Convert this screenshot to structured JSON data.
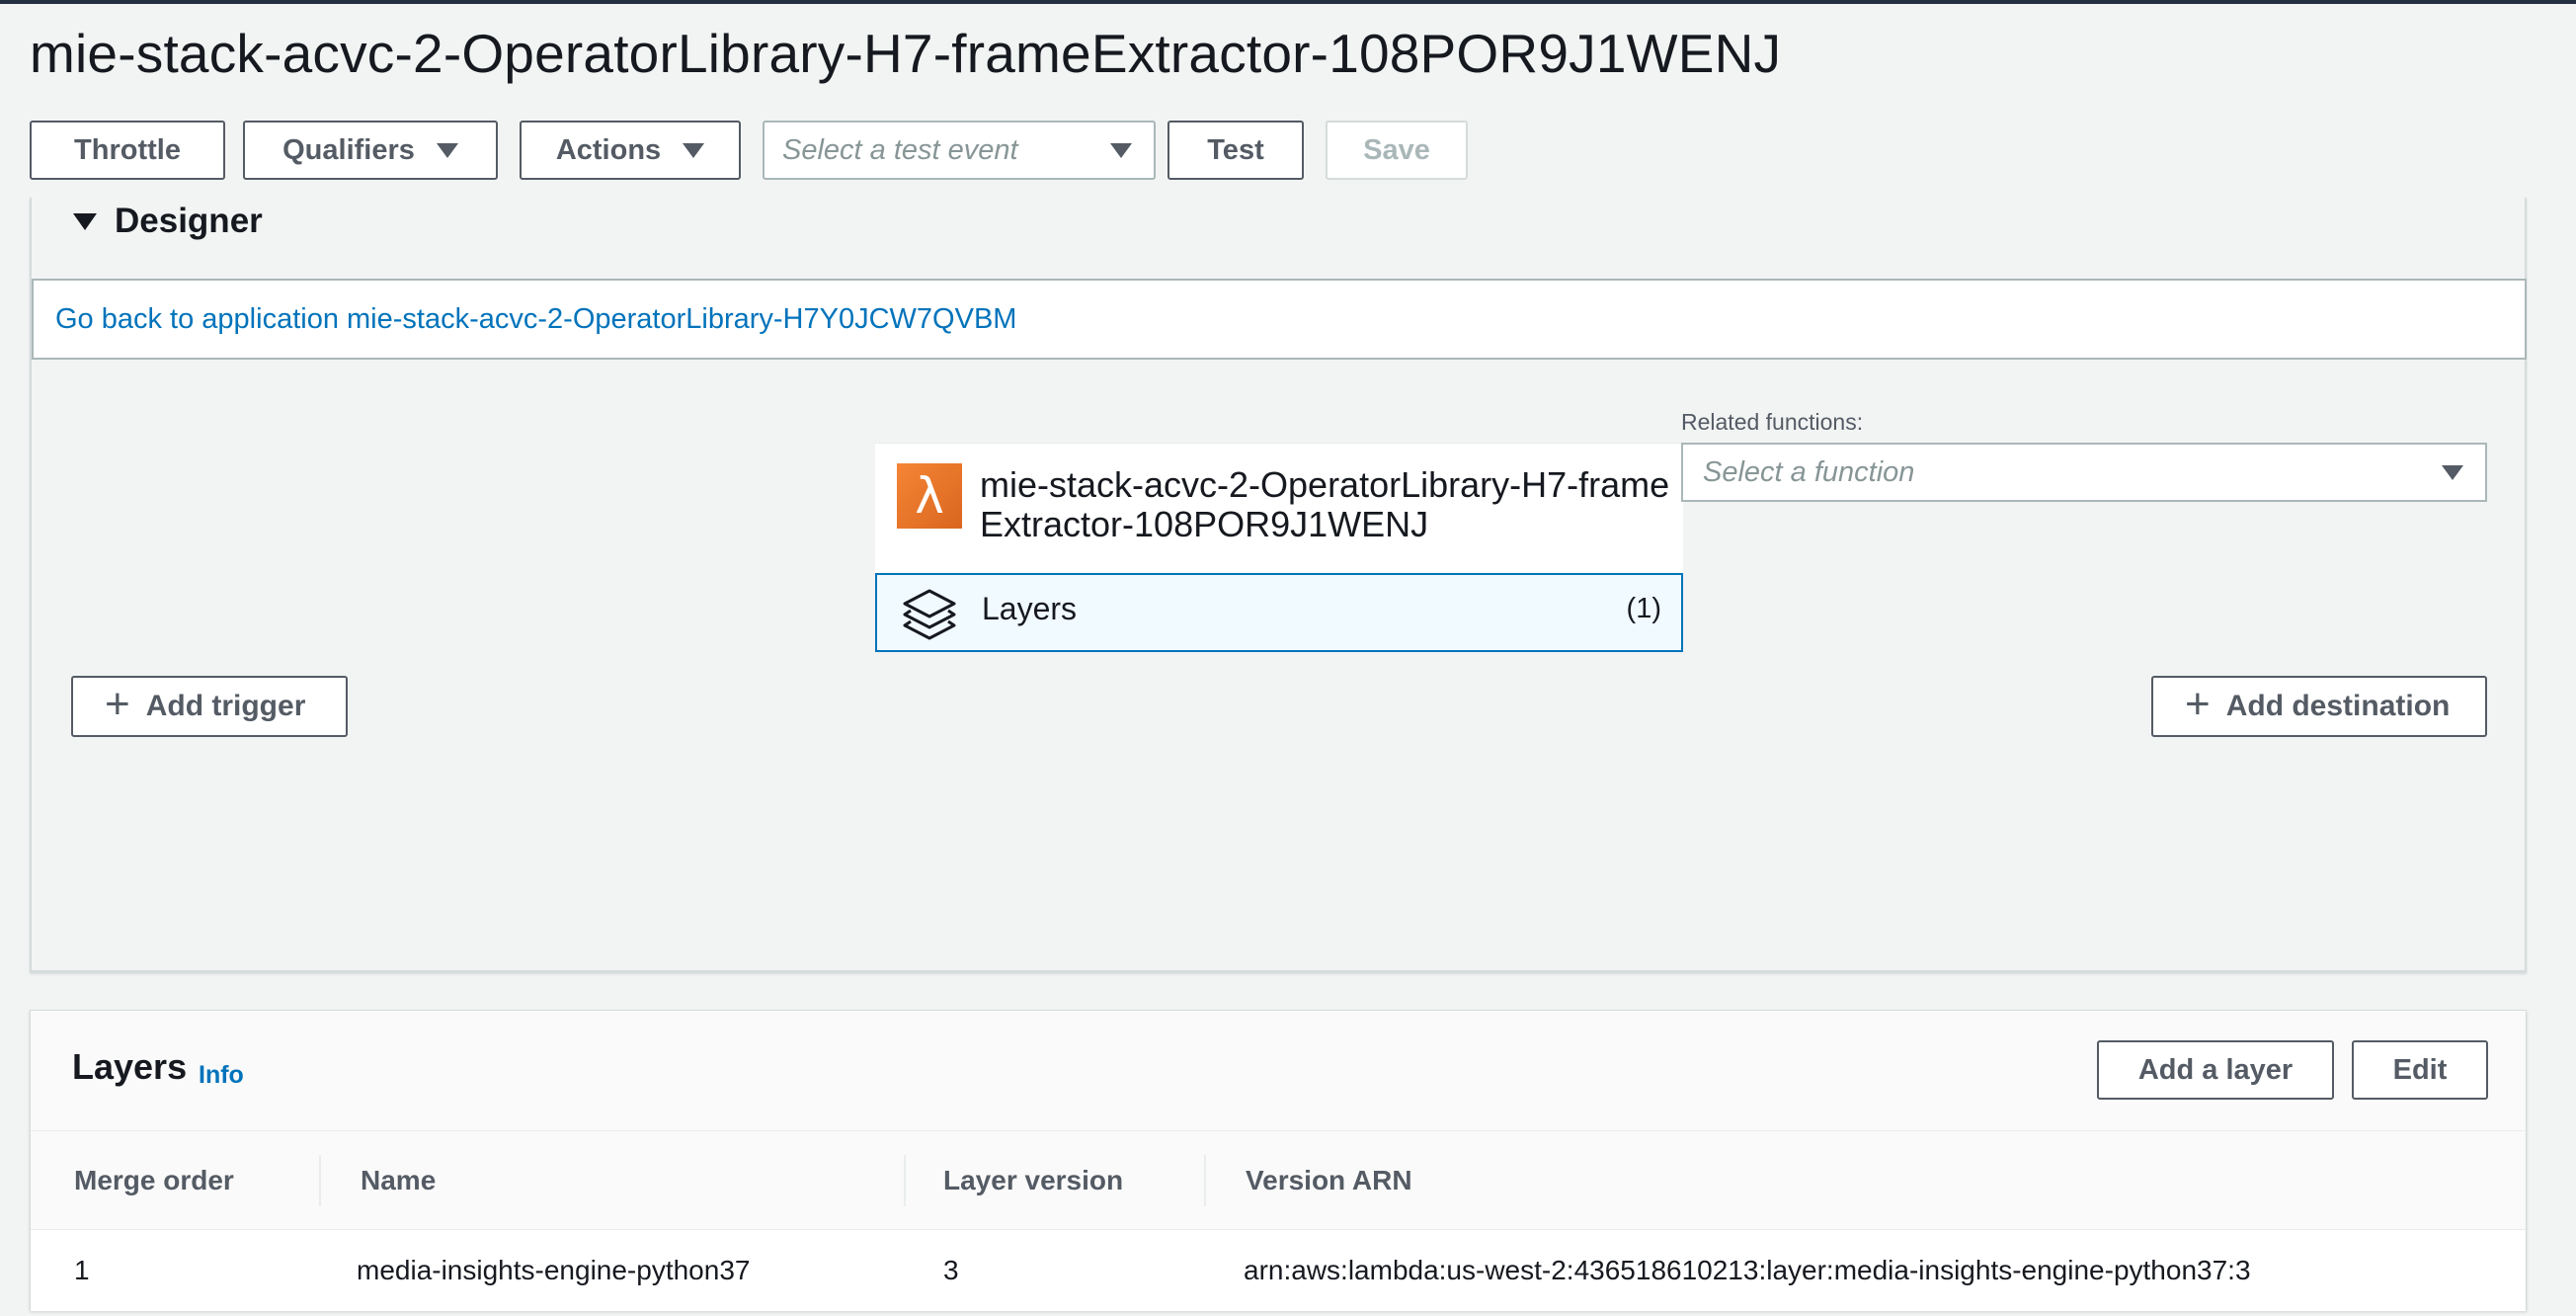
{
  "page": {
    "title": "mie-stack-acvc-2-OperatorLibrary-H7-frameExtractor-108POR9J1WENJ"
  },
  "toolbar": {
    "throttle": "Throttle",
    "qualifiers": "Qualifiers",
    "actions": "Actions",
    "test_event_placeholder": "Select a test event",
    "test": "Test",
    "save": "Save"
  },
  "designer": {
    "heading": "Designer",
    "go_back_link": "Go back to application mie-stack-acvc-2-OperatorLibrary-H7Y0JCW7QVBM",
    "function_name": "mie-stack-acvc-2-OperatorLibrary-H7-frameExtractor-108POR9J1WENJ",
    "function_icon": "λ",
    "layers_label": "Layers",
    "layers_count": "(1)",
    "related_functions_label": "Related functions:",
    "related_functions_placeholder": "Select a function",
    "add_trigger": "Add trigger",
    "add_destination": "Add destination"
  },
  "layers_panel": {
    "title": "Layers",
    "info": "Info",
    "add_layer": "Add a layer",
    "edit": "Edit",
    "columns": [
      "Merge order",
      "Name",
      "Layer version",
      "Version ARN"
    ],
    "rows": [
      {
        "merge_order": "1",
        "name": "media-insights-engine-python37",
        "layer_version": "3",
        "version_arn": "arn:aws:lambda:us-west-2:436518610213:layer:media-insights-engine-python37:3"
      }
    ]
  },
  "colors": {
    "link": "#0073bb",
    "lambda_orange": "#f68536",
    "selected_bg": "#f1faff",
    "button_border": "#545b64"
  }
}
